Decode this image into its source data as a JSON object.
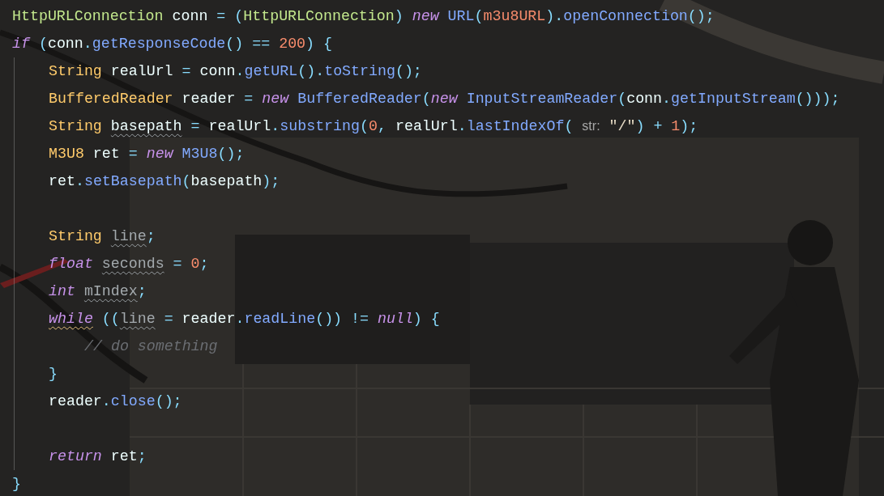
{
  "lines": [
    {
      "tokens": [
        {
          "kind": "type2",
          "text": "HttpURLConnection"
        },
        {
          "kind": "plain",
          "text": " conn "
        },
        {
          "kind": "punct",
          "text": "= ("
        },
        {
          "kind": "type2",
          "text": "HttpURLConnection"
        },
        {
          "kind": "punct",
          "text": ") "
        },
        {
          "kind": "keyword",
          "text": "new "
        },
        {
          "kind": "call",
          "text": "URL"
        },
        {
          "kind": "punct",
          "text": "("
        },
        {
          "kind": "number",
          "text": "m3u8URL"
        },
        {
          "kind": "punct",
          "text": ")."
        },
        {
          "kind": "call",
          "text": "openConnection"
        },
        {
          "kind": "punct",
          "text": "();"
        }
      ]
    },
    {
      "tokens": [
        {
          "kind": "keyword",
          "text": "if"
        },
        {
          "kind": "punct",
          "text": " ("
        },
        {
          "kind": "plain",
          "text": "conn"
        },
        {
          "kind": "punct",
          "text": "."
        },
        {
          "kind": "call",
          "text": "getResponseCode"
        },
        {
          "kind": "punct",
          "text": "() == "
        },
        {
          "kind": "number",
          "text": "200"
        },
        {
          "kind": "punct",
          "text": ") {"
        }
      ],
      "children": [
        {
          "tokens": [
            {
              "kind": "type",
              "text": "String"
            },
            {
              "kind": "plain",
              "text": " realUrl "
            },
            {
              "kind": "punct",
              "text": "= "
            },
            {
              "kind": "plain",
              "text": "conn"
            },
            {
              "kind": "punct",
              "text": "."
            },
            {
              "kind": "call",
              "text": "getURL"
            },
            {
              "kind": "punct",
              "text": "()."
            },
            {
              "kind": "call",
              "text": "toString"
            },
            {
              "kind": "punct",
              "text": "();"
            }
          ]
        },
        {
          "tokens": [
            {
              "kind": "type",
              "text": "BufferedReader"
            },
            {
              "kind": "plain",
              "text": " reader "
            },
            {
              "kind": "punct",
              "text": "= "
            },
            {
              "kind": "keyword",
              "text": "new "
            },
            {
              "kind": "call",
              "text": "BufferedReader"
            },
            {
              "kind": "punct",
              "text": "("
            },
            {
              "kind": "keyword",
              "text": "new "
            },
            {
              "kind": "call",
              "text": "InputStreamReader"
            },
            {
              "kind": "punct",
              "text": "("
            },
            {
              "kind": "plain",
              "text": "conn"
            },
            {
              "kind": "punct",
              "text": "."
            },
            {
              "kind": "call",
              "text": "getInputStream"
            },
            {
              "kind": "punct",
              "text": "()));"
            }
          ]
        },
        {
          "tokens": [
            {
              "kind": "type",
              "text": "String "
            },
            {
              "kind": "plain",
              "text": "basepath",
              "squiggle": true
            },
            {
              "kind": "punct",
              "text": " = "
            },
            {
              "kind": "plain",
              "text": "realUrl"
            },
            {
              "kind": "punct",
              "text": "."
            },
            {
              "kind": "call",
              "text": "substring"
            },
            {
              "kind": "punct",
              "text": "("
            },
            {
              "kind": "number",
              "text": "0"
            },
            {
              "kind": "punct",
              "text": ", "
            },
            {
              "kind": "plain",
              "text": "realUrl"
            },
            {
              "kind": "punct",
              "text": "."
            },
            {
              "kind": "call",
              "text": "lastIndexOf"
            },
            {
              "kind": "punct",
              "text": "( "
            },
            {
              "kind": "hint",
              "text": "str:"
            },
            {
              "kind": "string",
              "text": " \"/\""
            },
            {
              "kind": "punct",
              "text": ") + "
            },
            {
              "kind": "number",
              "text": "1"
            },
            {
              "kind": "punct",
              "text": ");"
            }
          ]
        },
        {
          "tokens": [
            {
              "kind": "type",
              "text": "M3U8"
            },
            {
              "kind": "plain",
              "text": " ret "
            },
            {
              "kind": "punct",
              "text": "= "
            },
            {
              "kind": "keyword",
              "text": "new "
            },
            {
              "kind": "call",
              "text": "M3U8"
            },
            {
              "kind": "punct",
              "text": "();"
            }
          ]
        },
        {
          "tokens": [
            {
              "kind": "plain",
              "text": "ret"
            },
            {
              "kind": "punct",
              "text": "."
            },
            {
              "kind": "call",
              "text": "setBasepath"
            },
            {
              "kind": "punct",
              "text": "("
            },
            {
              "kind": "plain",
              "text": "basepath"
            },
            {
              "kind": "punct",
              "text": ");"
            }
          ]
        },
        {
          "kind": "blank"
        },
        {
          "tokens": [
            {
              "kind": "type",
              "text": "String "
            },
            {
              "kind": "unused",
              "text": "line",
              "squiggle": true
            },
            {
              "kind": "punct",
              "text": ";"
            }
          ]
        },
        {
          "tokens": [
            {
              "kind": "keyword",
              "text": "float "
            },
            {
              "kind": "unused",
              "text": "seconds",
              "squiggle": true
            },
            {
              "kind": "punct",
              "text": " = "
            },
            {
              "kind": "number",
              "text": "0"
            },
            {
              "kind": "punct",
              "text": ";"
            }
          ]
        },
        {
          "tokens": [
            {
              "kind": "keyword",
              "text": "int "
            },
            {
              "kind": "unused",
              "text": "mIndex",
              "squiggle": true
            },
            {
              "kind": "punct",
              "text": ";"
            }
          ]
        },
        {
          "tokens": [
            {
              "kind": "keyword",
              "text": "while",
              "squiggle": true
            },
            {
              "kind": "punct",
              "text": " (("
            },
            {
              "kind": "unused",
              "text": "line",
              "squiggle": true
            },
            {
              "kind": "punct",
              "text": " = "
            },
            {
              "kind": "plain",
              "text": "reader"
            },
            {
              "kind": "punct",
              "text": "."
            },
            {
              "kind": "call",
              "text": "readLine"
            },
            {
              "kind": "punct",
              "text": "()) != "
            },
            {
              "kind": "keyword",
              "text": "null"
            },
            {
              "kind": "punct",
              "text": ") {"
            }
          ],
          "children": [
            {
              "tokens": [
                {
                  "kind": "comment",
                  "text": "// do something"
                }
              ]
            }
          ]
        },
        {
          "tokens": [
            {
              "kind": "punct",
              "text": "}"
            }
          ]
        },
        {
          "tokens": [
            {
              "kind": "plain",
              "text": "reader"
            },
            {
              "kind": "punct",
              "text": "."
            },
            {
              "kind": "call",
              "text": "close"
            },
            {
              "kind": "punct",
              "text": "();"
            }
          ]
        },
        {
          "kind": "blank"
        },
        {
          "tokens": [
            {
              "kind": "keyword",
              "text": "return"
            },
            {
              "kind": "plain",
              "text": " ret"
            },
            {
              "kind": "punct",
              "text": ";"
            }
          ]
        }
      ]
    },
    {
      "tokens": [
        {
          "kind": "punct",
          "text": "}"
        }
      ]
    }
  ]
}
